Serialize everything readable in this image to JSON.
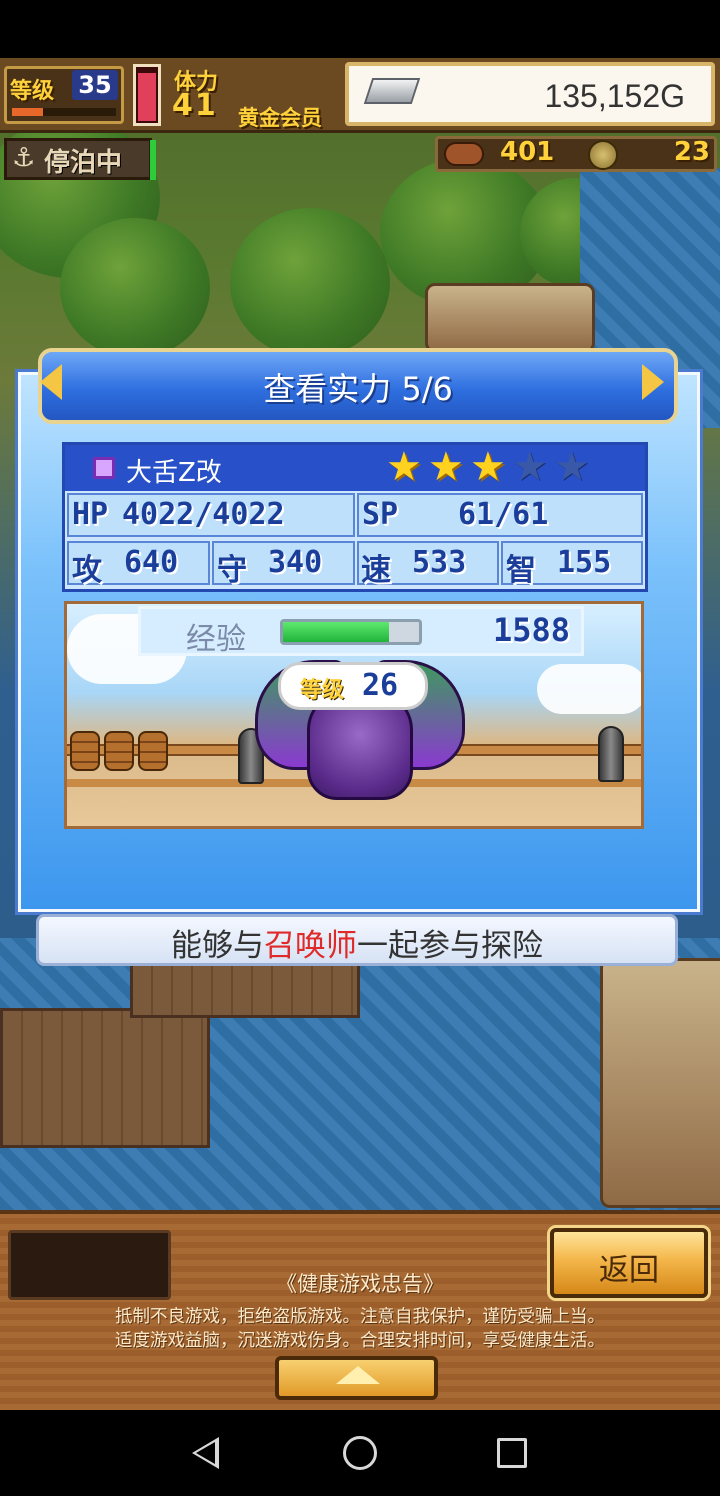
{
  "hud": {
    "level_label": "等级",
    "level_value": "35",
    "level_progress": 0.3,
    "stamina_label": "体力",
    "stamina_value": "41",
    "stamina_fill": 0.85,
    "member_label": "黄金会员",
    "gold_value": "135,152G",
    "dock_status": "停泊中",
    "food_value": "401",
    "medal_value": "23"
  },
  "dialog": {
    "title": "查看实力 5/6",
    "monster": {
      "name": "大舌Z改",
      "stars_filled": 3,
      "stars_total": 5
    },
    "stats": {
      "hp_label": "HP",
      "hp_value": "4022/4022",
      "sp_label": "SP",
      "sp_value": "61/61",
      "atk_label": "攻",
      "atk_value": "640",
      "def_label": "守",
      "def_value": "340",
      "spd_label": "速",
      "spd_value": "533",
      "int_label": "智",
      "int_value": "155"
    },
    "exp": {
      "label": "经验",
      "value": "1588",
      "progress": 0.78
    },
    "level_bubble": {
      "label": "等级",
      "value": "26"
    },
    "description": {
      "before": "能够与",
      "highlight": "召唤师",
      "after": "一起参与探险"
    }
  },
  "bottom": {
    "back_label": "返回",
    "notice_title": "《健康游戏忠告》",
    "notice_line1": "抵制不良游戏，拒绝盗版游戏。注意自我保护，谨防受骗上当。",
    "notice_line2": "适度游戏益脑，沉迷游戏伤身。合理安排时间，享受健康生活。"
  },
  "icons": {
    "gold": "silver-bar-icon",
    "anchor": "anchor-icon",
    "food": "meat-icon",
    "medal": "medal-icon"
  },
  "colors": {
    "dialog_blue": "#3d97ee",
    "title_blue": "#2f6fe0",
    "highlight_red": "#e02a2a",
    "star_gold": "#ffd21f",
    "exp_green": "#20b43a"
  }
}
